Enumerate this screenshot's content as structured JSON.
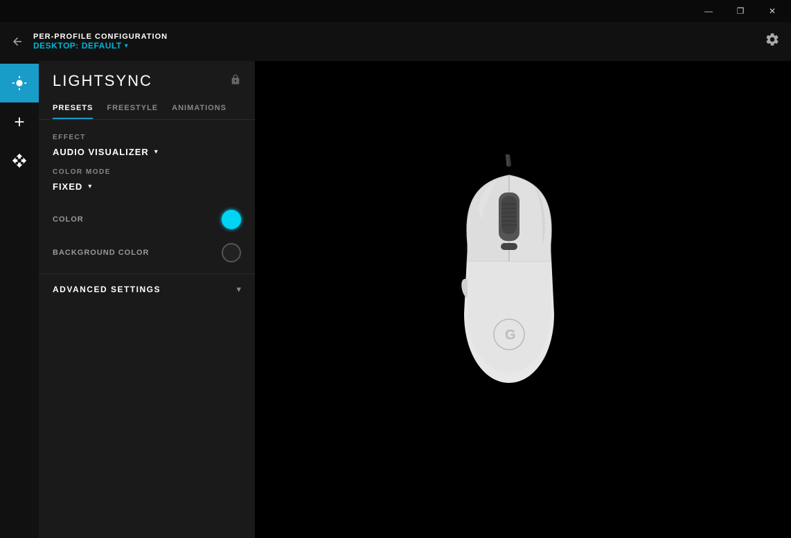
{
  "titlebar": {
    "minimize_label": "—",
    "restore_label": "❐",
    "close_label": "✕"
  },
  "header": {
    "title": "PER-PROFILE CONFIGURATION",
    "profile_prefix": "DESKTOP:",
    "profile_name": "Default",
    "profile_arrow": "▾",
    "back_arrow": "←",
    "gear_icon": "⚙"
  },
  "sidebar": {
    "items": [
      {
        "id": "lightsync",
        "label": "Lightsync",
        "active": true
      },
      {
        "id": "add",
        "label": "Add",
        "active": false
      },
      {
        "id": "move",
        "label": "Move",
        "active": false
      }
    ]
  },
  "panel": {
    "title": "LIGHTSYNC",
    "lock_icon": "🔒",
    "tabs": [
      {
        "id": "presets",
        "label": "PRESETS",
        "active": true
      },
      {
        "id": "freestyle",
        "label": "FREESTYLE",
        "active": false
      },
      {
        "id": "animations",
        "label": "ANIMATIONS",
        "active": false
      }
    ],
    "effect": {
      "label": "EFFECT",
      "value": "AUDIO VISUALIZER",
      "arrow": "▾"
    },
    "color_mode": {
      "label": "COLOR MODE",
      "value": "FIXED",
      "arrow": "▾"
    },
    "color": {
      "label": "COLOR"
    },
    "background_color": {
      "label": "BACKGROUND COLOR"
    },
    "advanced_settings": {
      "label": "ADVANCED SETTINGS",
      "arrow": "▾"
    }
  },
  "colors": {
    "accent": "#1a9cc9",
    "cyan_swatch": "#00d4f5"
  }
}
